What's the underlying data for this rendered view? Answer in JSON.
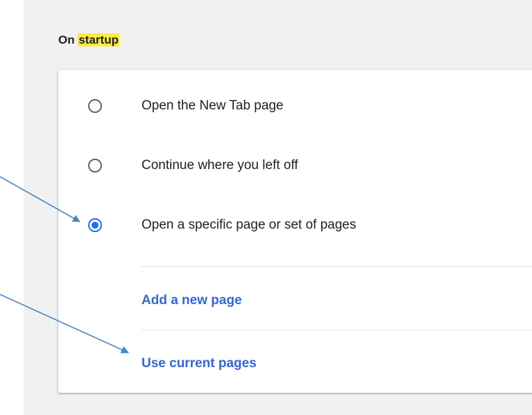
{
  "section": {
    "title_prefix": "On",
    "title_highlight": "startup"
  },
  "options": [
    {
      "label": "Open the New Tab page",
      "selected": false
    },
    {
      "label": "Continue where you left off",
      "selected": false
    },
    {
      "label": "Open a specific page or set of pages",
      "selected": true
    }
  ],
  "links": {
    "add_page": "Add a new page",
    "use_current": "Use current pages"
  },
  "colors": {
    "accent": "#1a73e8",
    "link": "#3367d6",
    "highlight": "#ffeb3b",
    "annotation_arrow": "#4a86c0"
  }
}
